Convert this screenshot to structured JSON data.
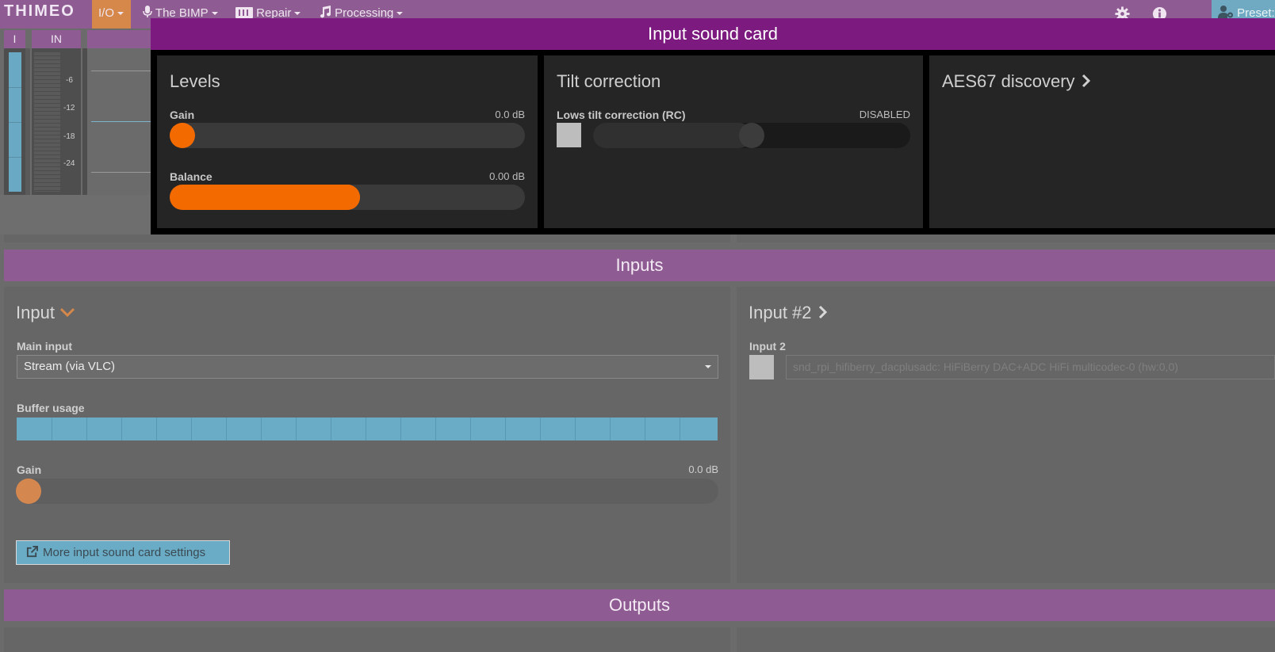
{
  "navbar": {
    "brand": "THIMEO",
    "menus": [
      {
        "label": "I/O"
      },
      {
        "label": "The BIMP"
      },
      {
        "label": "Repair"
      },
      {
        "label": "Processing"
      }
    ],
    "preset_label": "Preset:",
    "icons": {
      "settings": "gear-icon",
      "info": "info-icon",
      "user": "user-gear-icon"
    }
  },
  "meters": {
    "left_header": "I",
    "in_header": "IN",
    "scale": [
      "-6",
      "-12",
      "-18",
      "-24"
    ],
    "color": "#6aa9c3"
  },
  "modal": {
    "title": "Input sound card",
    "levels": {
      "title": "Levels",
      "gain": {
        "label": "Gain",
        "value": "0.0 dB",
        "position": 0.0
      },
      "balance": {
        "label": "Balance",
        "value": "0.00 dB",
        "position": 0.5
      }
    },
    "tilt": {
      "title": "Tilt correction",
      "lows": {
        "label": "Lows tilt correction (RC)",
        "status": "DISABLED",
        "enabled": false,
        "position": 0.5
      }
    },
    "aes67": {
      "title": "AES67 discovery"
    },
    "accent": "#f26a00",
    "header_color": "#7c1a7f"
  },
  "inputs": {
    "section_title": "Inputs",
    "input1": {
      "title": "Input",
      "main_input_label": "Main input",
      "main_input_value": "Stream (via VLC)",
      "buffer_label": "Buffer usage",
      "buffer_level": 1.0,
      "gain_label": "Gain",
      "gain_value": "0.0 dB",
      "more_button": "More input sound card settings"
    },
    "input2": {
      "title": "Input #2",
      "label": "Input 2",
      "device": "snd_rpi_hifiberry_dacplusadc: HiFiBerry DAC+ADC HiFi multicodec-0 (hw:0,0)",
      "enabled": false
    }
  },
  "outputs": {
    "section_title": "Outputs"
  }
}
